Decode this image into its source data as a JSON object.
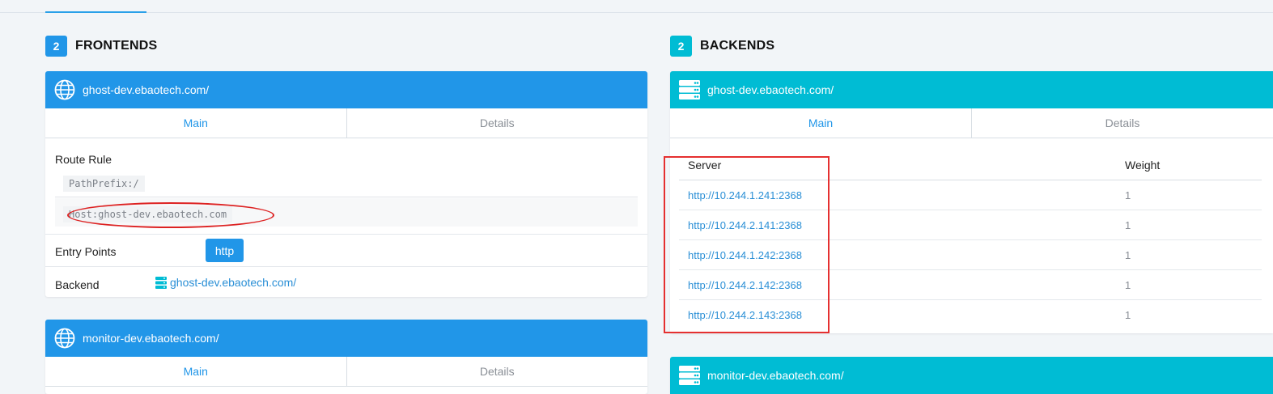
{
  "colors": {
    "frontend": "#2196e8",
    "backend": "#00bcd4",
    "link": "#2a8fd6",
    "annotation": "#e53030"
  },
  "frontends": {
    "count": "2",
    "title": "FRONTENDS",
    "cards": [
      {
        "name": "ghost-dev.ebaotech.com/",
        "icon": "globe-icon",
        "tabs": [
          "Main",
          "Details"
        ],
        "route_rule_label": "Route Rule",
        "rules": [
          "PathPrefix:/",
          "Host:ghost-dev.ebaotech.com"
        ],
        "entry_points_label": "Entry Points",
        "entry_point": "http",
        "backend_label": "Backend",
        "backend_icon": "server-icon",
        "backend_link": "ghost-dev.ebaotech.com/"
      },
      {
        "name": "monitor-dev.ebaotech.com/",
        "icon": "globe-icon",
        "tabs": [
          "Main",
          "Details"
        ]
      }
    ]
  },
  "backends": {
    "count": "2",
    "title": "BACKENDS",
    "cards": [
      {
        "name": "ghost-dev.ebaotech.com/",
        "icon": "server-icon",
        "tabs": [
          "Main",
          "Details"
        ],
        "columns": [
          "Server",
          "Weight"
        ],
        "servers": [
          {
            "url": "http://10.244.1.241:2368",
            "weight": "1"
          },
          {
            "url": "http://10.244.2.141:2368",
            "weight": "1"
          },
          {
            "url": "http://10.244.1.242:2368",
            "weight": "1"
          },
          {
            "url": "http://10.244.2.142:2368",
            "weight": "1"
          },
          {
            "url": "http://10.244.2.143:2368",
            "weight": "1"
          }
        ]
      },
      {
        "name": "monitor-dev.ebaotech.com/",
        "icon": "server-icon"
      }
    ]
  }
}
